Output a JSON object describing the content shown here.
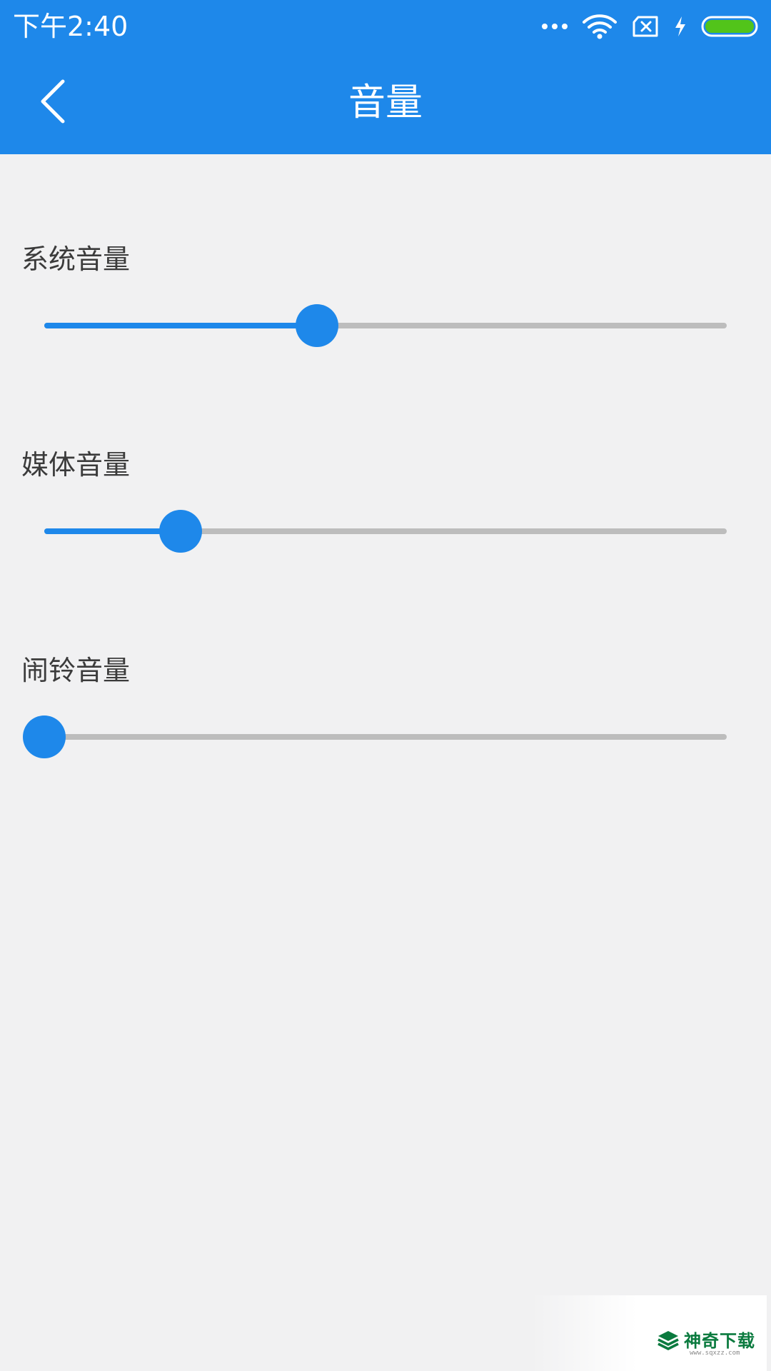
{
  "status_bar": {
    "time": "下午2:40",
    "icons": [
      "more-dots-icon",
      "wifi-icon",
      "sim-none-icon",
      "charging-icon",
      "battery-icon"
    ],
    "battery_color": "#52c41a"
  },
  "app_bar": {
    "back_icon": "chevron-left-icon",
    "title": "音量",
    "background": "#1e88ea"
  },
  "volumes": [
    {
      "label": "系统音量",
      "value": 0.4
    },
    {
      "label": "媒体音量",
      "value": 0.2
    },
    {
      "label": "闹铃音量",
      "value": 0.0
    }
  ],
  "accent_color": "#1e88ea",
  "watermark": {
    "text": "神奇下载",
    "url": "www.sqxzz.com"
  }
}
